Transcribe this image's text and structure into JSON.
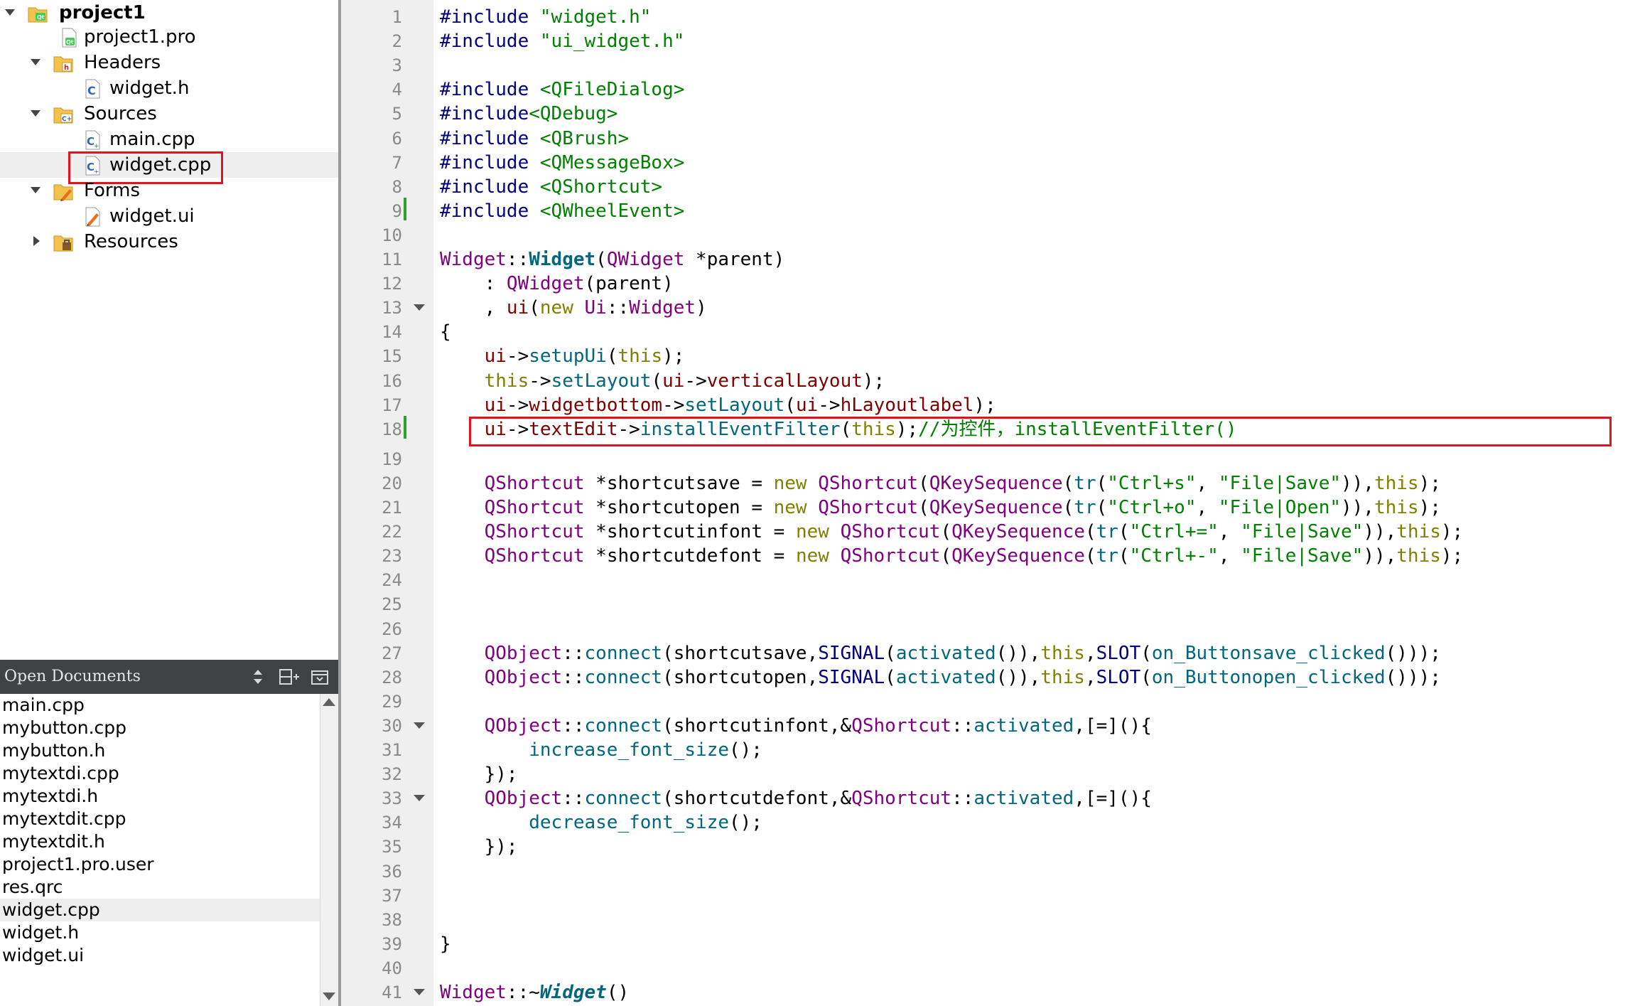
{
  "project_tree": {
    "root": "project1",
    "items": [
      {
        "label": "project1.pro"
      },
      {
        "label": "Headers"
      },
      {
        "label": "widget.h"
      },
      {
        "label": "Sources"
      },
      {
        "label": "main.cpp"
      },
      {
        "label": "widget.cpp"
      },
      {
        "label": "Forms"
      },
      {
        "label": "widget.ui"
      },
      {
        "label": "Resources"
      }
    ],
    "selected": "widget.cpp"
  },
  "open_documents": {
    "title": "Open Documents",
    "files": [
      "main.cpp",
      "mybutton.cpp",
      "mybutton.h",
      "mytextdi.cpp",
      "mytextdi.h",
      "mytextdit.cpp",
      "mytextdit.h",
      "project1.pro.user",
      "res.qrc",
      "widget.cpp",
      "widget.h",
      "widget.ui"
    ],
    "selected": "widget.cpp"
  },
  "colors": {
    "highlight_box": "#e0141e",
    "modified_bar": "#2da12d",
    "keyword": "#808000",
    "type": "#800080",
    "string": "#008000",
    "function": "#00677c"
  },
  "editor": {
    "line_numbers": [
      "1",
      "2",
      "3",
      "4",
      "5",
      "6",
      "7",
      "8",
      "9",
      "10",
      "11",
      "12",
      "13",
      "14",
      "15",
      "16",
      "17",
      "18",
      "19",
      "20",
      "21",
      "22",
      "23",
      "24",
      "25",
      "26",
      "27",
      "28",
      "29",
      "30",
      "31",
      "32",
      "33",
      "34",
      "35",
      "36",
      "37",
      "38",
      "39",
      "40",
      "41"
    ],
    "lines": [
      [
        {
          "c": "pp",
          "t": "#include "
        },
        {
          "c": "str",
          "t": "\"widget.h\""
        }
      ],
      [
        {
          "c": "pp",
          "t": "#include "
        },
        {
          "c": "str",
          "t": "\"ui_widget.h\""
        }
      ],
      [],
      [
        {
          "c": "pp",
          "t": "#include "
        },
        {
          "c": "str",
          "t": "<QFileDialog>"
        }
      ],
      [
        {
          "c": "pp",
          "t": "#include"
        },
        {
          "c": "str",
          "t": "<QDebug>"
        }
      ],
      [
        {
          "c": "pp",
          "t": "#include "
        },
        {
          "c": "str",
          "t": "<QBrush>"
        }
      ],
      [
        {
          "c": "pp",
          "t": "#include "
        },
        {
          "c": "str",
          "t": "<QMessageBox>"
        }
      ],
      [
        {
          "c": "pp",
          "t": "#include "
        },
        {
          "c": "str",
          "t": "<QShortcut>"
        }
      ],
      [
        {
          "c": "pp",
          "t": "#include "
        },
        {
          "c": "str",
          "t": "<QWheelEvent>"
        }
      ],
      [],
      [
        {
          "c": "typ",
          "t": "Widget"
        },
        {
          "c": "",
          "t": "::"
        },
        {
          "c": "bfn",
          "t": "Widget"
        },
        {
          "c": "",
          "t": "("
        },
        {
          "c": "typ",
          "t": "QWidget"
        },
        {
          "c": "",
          "t": " *parent)"
        }
      ],
      [
        {
          "c": "",
          "t": "    : "
        },
        {
          "c": "typ",
          "t": "QWidget"
        },
        {
          "c": "",
          "t": "(parent)"
        }
      ],
      [
        {
          "c": "",
          "t": "    , "
        },
        {
          "c": "mem",
          "t": "ui"
        },
        {
          "c": "",
          "t": "("
        },
        {
          "c": "kw",
          "t": "new"
        },
        {
          "c": "",
          "t": " "
        },
        {
          "c": "typ",
          "t": "Ui"
        },
        {
          "c": "",
          "t": "::"
        },
        {
          "c": "typ",
          "t": "Widget"
        },
        {
          "c": "",
          "t": ")"
        }
      ],
      [
        {
          "c": "",
          "t": "{"
        }
      ],
      [
        {
          "c": "",
          "t": "    "
        },
        {
          "c": "mem",
          "t": "ui"
        },
        {
          "c": "",
          "t": "->"
        },
        {
          "c": "fn",
          "t": "setupUi"
        },
        {
          "c": "",
          "t": "("
        },
        {
          "c": "kw",
          "t": "this"
        },
        {
          "c": "",
          "t": ");"
        }
      ],
      [
        {
          "c": "",
          "t": "    "
        },
        {
          "c": "kw",
          "t": "this"
        },
        {
          "c": "",
          "t": "->"
        },
        {
          "c": "fn",
          "t": "setLayout"
        },
        {
          "c": "",
          "t": "("
        },
        {
          "c": "mem",
          "t": "ui"
        },
        {
          "c": "",
          "t": "->"
        },
        {
          "c": "mem",
          "t": "verticalLayout"
        },
        {
          "c": "",
          "t": ");"
        }
      ],
      [
        {
          "c": "",
          "t": "    "
        },
        {
          "c": "mem",
          "t": "ui"
        },
        {
          "c": "",
          "t": "->"
        },
        {
          "c": "mem",
          "t": "widgetbottom"
        },
        {
          "c": "",
          "t": "->"
        },
        {
          "c": "fn",
          "t": "setLayout"
        },
        {
          "c": "",
          "t": "("
        },
        {
          "c": "mem",
          "t": "ui"
        },
        {
          "c": "",
          "t": "->"
        },
        {
          "c": "mem",
          "t": "hLayoutlabel"
        },
        {
          "c": "",
          "t": ");"
        }
      ],
      [
        {
          "c": "",
          "t": "    "
        },
        {
          "c": "mem",
          "t": "ui"
        },
        {
          "c": "",
          "t": "->"
        },
        {
          "c": "mem",
          "t": "textEdit"
        },
        {
          "c": "",
          "t": "->"
        },
        {
          "c": "fn",
          "t": "installEventFilter"
        },
        {
          "c": "",
          "t": "("
        },
        {
          "c": "kw",
          "t": "this"
        },
        {
          "c": "",
          "t": ");"
        },
        {
          "c": "cm",
          "t": "//为控件，installEventFilter()"
        }
      ],
      [],
      [
        {
          "c": "",
          "t": "    "
        },
        {
          "c": "typ",
          "t": "QShortcut"
        },
        {
          "c": "",
          "t": " *shortcutsave = "
        },
        {
          "c": "kw",
          "t": "new"
        },
        {
          "c": "",
          "t": " "
        },
        {
          "c": "typ",
          "t": "QShortcut"
        },
        {
          "c": "",
          "t": "("
        },
        {
          "c": "typ",
          "t": "QKeySequence"
        },
        {
          "c": "",
          "t": "("
        },
        {
          "c": "fn",
          "t": "tr"
        },
        {
          "c": "",
          "t": "("
        },
        {
          "c": "str",
          "t": "\"Ctrl+s\""
        },
        {
          "c": "",
          "t": ", "
        },
        {
          "c": "str",
          "t": "\"File|Save\""
        },
        {
          "c": "",
          "t": ")),"
        },
        {
          "c": "kw",
          "t": "this"
        },
        {
          "c": "",
          "t": ");"
        }
      ],
      [
        {
          "c": "",
          "t": "    "
        },
        {
          "c": "typ",
          "t": "QShortcut"
        },
        {
          "c": "",
          "t": " *shortcutopen = "
        },
        {
          "c": "kw",
          "t": "new"
        },
        {
          "c": "",
          "t": " "
        },
        {
          "c": "typ",
          "t": "QShortcut"
        },
        {
          "c": "",
          "t": "("
        },
        {
          "c": "typ",
          "t": "QKeySequence"
        },
        {
          "c": "",
          "t": "("
        },
        {
          "c": "fn",
          "t": "tr"
        },
        {
          "c": "",
          "t": "("
        },
        {
          "c": "str",
          "t": "\"Ctrl+o\""
        },
        {
          "c": "",
          "t": ", "
        },
        {
          "c": "str",
          "t": "\"File|Open\""
        },
        {
          "c": "",
          "t": ")),"
        },
        {
          "c": "kw",
          "t": "this"
        },
        {
          "c": "",
          "t": ");"
        }
      ],
      [
        {
          "c": "",
          "t": "    "
        },
        {
          "c": "typ",
          "t": "QShortcut"
        },
        {
          "c": "",
          "t": " *shortcutinfont = "
        },
        {
          "c": "kw",
          "t": "new"
        },
        {
          "c": "",
          "t": " "
        },
        {
          "c": "typ",
          "t": "QShortcut"
        },
        {
          "c": "",
          "t": "("
        },
        {
          "c": "typ",
          "t": "QKeySequence"
        },
        {
          "c": "",
          "t": "("
        },
        {
          "c": "fn",
          "t": "tr"
        },
        {
          "c": "",
          "t": "("
        },
        {
          "c": "str",
          "t": "\"Ctrl+=\""
        },
        {
          "c": "",
          "t": ", "
        },
        {
          "c": "str",
          "t": "\"File|Save\""
        },
        {
          "c": "",
          "t": ")),"
        },
        {
          "c": "kw",
          "t": "this"
        },
        {
          "c": "",
          "t": ");"
        }
      ],
      [
        {
          "c": "",
          "t": "    "
        },
        {
          "c": "typ",
          "t": "QShortcut"
        },
        {
          "c": "",
          "t": " *shortcutdefont = "
        },
        {
          "c": "kw",
          "t": "new"
        },
        {
          "c": "",
          "t": " "
        },
        {
          "c": "typ",
          "t": "QShortcut"
        },
        {
          "c": "",
          "t": "("
        },
        {
          "c": "typ",
          "t": "QKeySequence"
        },
        {
          "c": "",
          "t": "("
        },
        {
          "c": "fn",
          "t": "tr"
        },
        {
          "c": "",
          "t": "("
        },
        {
          "c": "str",
          "t": "\"Ctrl+-\""
        },
        {
          "c": "",
          "t": ", "
        },
        {
          "c": "str",
          "t": "\"File|Save\""
        },
        {
          "c": "",
          "t": ")),"
        },
        {
          "c": "kw",
          "t": "this"
        },
        {
          "c": "",
          "t": ");"
        }
      ],
      [],
      [],
      [],
      [
        {
          "c": "",
          "t": "    "
        },
        {
          "c": "typ",
          "t": "QObject"
        },
        {
          "c": "",
          "t": "::"
        },
        {
          "c": "fn",
          "t": "connect"
        },
        {
          "c": "",
          "t": "(shortcutsave,"
        },
        {
          "c": "mac",
          "t": "SIGNAL"
        },
        {
          "c": "",
          "t": "("
        },
        {
          "c": "fn",
          "t": "activated"
        },
        {
          "c": "",
          "t": "()),"
        },
        {
          "c": "kw",
          "t": "this"
        },
        {
          "c": "",
          "t": ","
        },
        {
          "c": "mac",
          "t": "SLOT"
        },
        {
          "c": "",
          "t": "("
        },
        {
          "c": "fn",
          "t": "on_Buttonsave_clicked"
        },
        {
          "c": "",
          "t": "()));"
        }
      ],
      [
        {
          "c": "",
          "t": "    "
        },
        {
          "c": "typ",
          "t": "QObject"
        },
        {
          "c": "",
          "t": "::"
        },
        {
          "c": "fn",
          "t": "connect"
        },
        {
          "c": "",
          "t": "(shortcutopen,"
        },
        {
          "c": "mac",
          "t": "SIGNAL"
        },
        {
          "c": "",
          "t": "("
        },
        {
          "c": "fn",
          "t": "activated"
        },
        {
          "c": "",
          "t": "()),"
        },
        {
          "c": "kw",
          "t": "this"
        },
        {
          "c": "",
          "t": ","
        },
        {
          "c": "mac",
          "t": "SLOT"
        },
        {
          "c": "",
          "t": "("
        },
        {
          "c": "fn",
          "t": "on_Buttonopen_clicked"
        },
        {
          "c": "",
          "t": "()));"
        }
      ],
      [],
      [
        {
          "c": "",
          "t": "    "
        },
        {
          "c": "typ",
          "t": "QObject"
        },
        {
          "c": "",
          "t": "::"
        },
        {
          "c": "fn",
          "t": "connect"
        },
        {
          "c": "",
          "t": "(shortcutinfont,&"
        },
        {
          "c": "typ",
          "t": "QShortcut"
        },
        {
          "c": "",
          "t": "::"
        },
        {
          "c": "fn",
          "t": "activated"
        },
        {
          "c": "",
          "t": ",[=](){"
        }
      ],
      [
        {
          "c": "",
          "t": "        "
        },
        {
          "c": "fn",
          "t": "increase_font_size"
        },
        {
          "c": "",
          "t": "();"
        }
      ],
      [
        {
          "c": "",
          "t": "    });"
        }
      ],
      [
        {
          "c": "",
          "t": "    "
        },
        {
          "c": "typ",
          "t": "QObject"
        },
        {
          "c": "",
          "t": "::"
        },
        {
          "c": "fn",
          "t": "connect"
        },
        {
          "c": "",
          "t": "(shortcutdefont,&"
        },
        {
          "c": "typ",
          "t": "QShortcut"
        },
        {
          "c": "",
          "t": "::"
        },
        {
          "c": "fn",
          "t": "activated"
        },
        {
          "c": "",
          "t": ",[=](){"
        }
      ],
      [
        {
          "c": "",
          "t": "        "
        },
        {
          "c": "fn",
          "t": "decrease_font_size"
        },
        {
          "c": "",
          "t": "();"
        }
      ],
      [
        {
          "c": "",
          "t": "    });"
        }
      ],
      [],
      [],
      [],
      [
        {
          "c": "",
          "t": "}"
        }
      ],
      [],
      [
        {
          "c": "typ",
          "t": "Widget"
        },
        {
          "c": "",
          "t": "::~"
        },
        {
          "c": "ifn",
          "t": "Widget"
        },
        {
          "c": "",
          "t": "()"
        }
      ]
    ]
  }
}
